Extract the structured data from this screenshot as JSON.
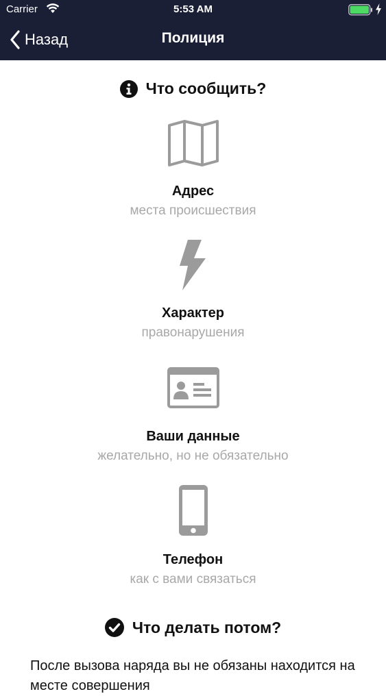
{
  "status_bar": {
    "carrier": "Carrier",
    "time": "5:53 AM",
    "battery_color": "#4cd964"
  },
  "nav": {
    "back_label": "Назад",
    "title": "Полиция"
  },
  "report_section": {
    "title": "Что сообщить?",
    "items": [
      {
        "icon": "map-icon",
        "title": "Адрес",
        "subtitle": "места происшествия"
      },
      {
        "icon": "lightning-icon",
        "title": "Характер",
        "subtitle": "правонарушения"
      },
      {
        "icon": "id-card-icon",
        "title": "Ваши данные",
        "subtitle": "желательно, но не обязательно"
      },
      {
        "icon": "phone-icon",
        "title": "Телефон",
        "subtitle": "как с вами связаться"
      }
    ]
  },
  "next_section": {
    "title": "Что делать потом?",
    "text": "После вызова наряда вы не обязаны находится на месте совершения"
  },
  "colors": {
    "header_bg": "#1b1f36",
    "icon_gray": "#9b9b9b",
    "subtitle_gray": "#a8a8a8"
  }
}
